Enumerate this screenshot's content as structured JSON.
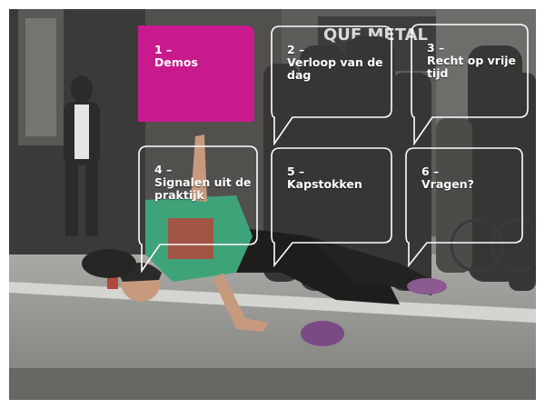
{
  "colors": {
    "accent": "#c81a8d",
    "bubble_outline": "#ffffff",
    "text": "#ffffff"
  },
  "photo": {
    "icon": "breakdancer-street-photo",
    "sign_text": "QUE METAL"
  },
  "bubbles": [
    {
      "number": "1 –",
      "label": "Demos",
      "active": true
    },
    {
      "number": "2 –",
      "label": "Verloop van de dag",
      "active": false
    },
    {
      "number": "3 –",
      "label": "Recht op vrije tijd",
      "active": false
    },
    {
      "number": "4 –",
      "label": "Signalen uit de praktijk",
      "active": false
    },
    {
      "number": "5 –",
      "label": "Kapstokken",
      "active": false
    },
    {
      "number": "6 –",
      "label": "Vragen?",
      "active": false
    }
  ]
}
